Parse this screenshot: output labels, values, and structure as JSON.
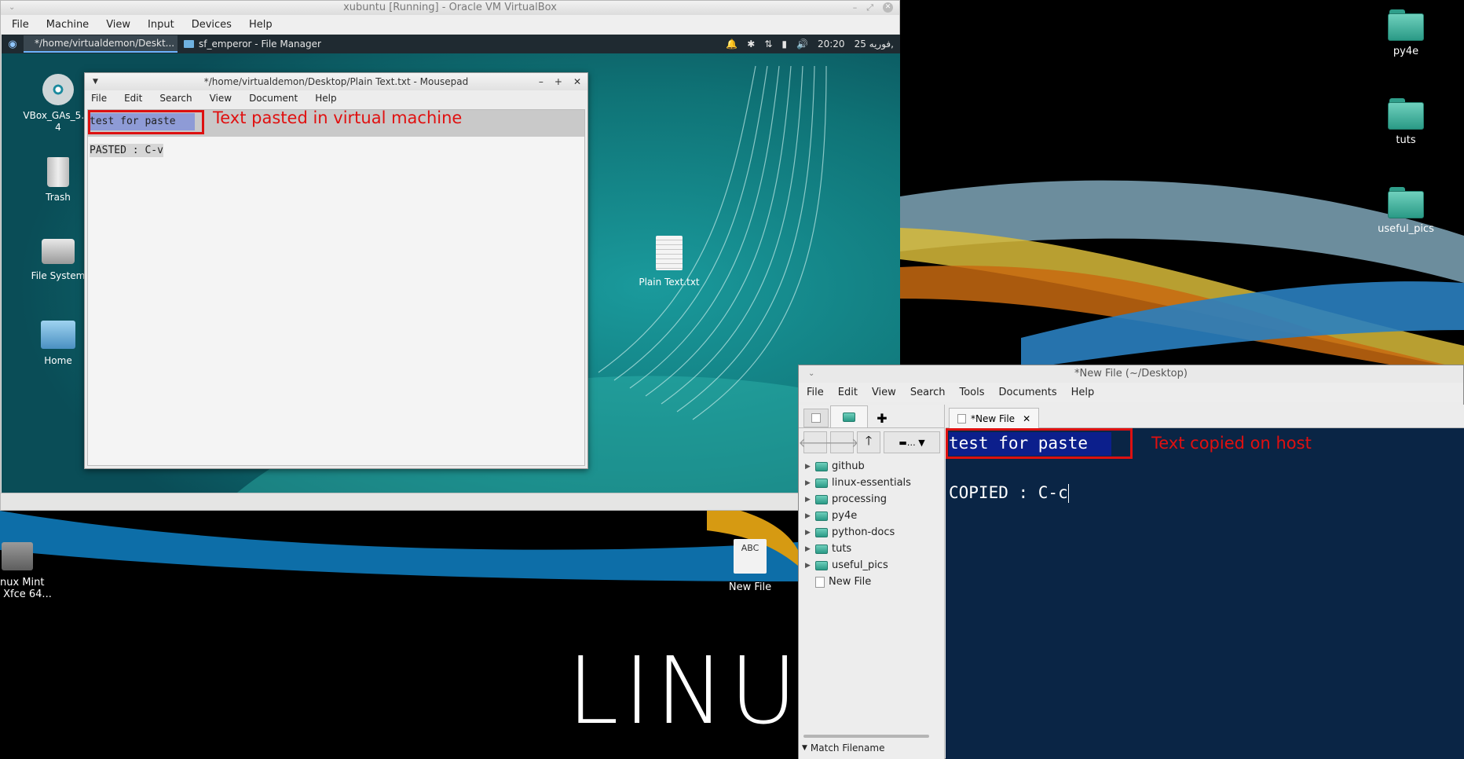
{
  "vbox": {
    "title": "xubuntu [Running] - Oracle VM VirtualBox",
    "menu": [
      "File",
      "Machine",
      "View",
      "Input",
      "Devices",
      "Help"
    ]
  },
  "guest_panel": {
    "tasks": [
      "*/home/virtualdemon/Deskt...",
      "sf_emperor - File Manager"
    ],
    "clock": "20:20",
    "date": "25 فوریه,"
  },
  "guest_desktop": {
    "icons": [
      "VBox_GAs_5.2.\n4",
      "Trash",
      "File System",
      "Home",
      "Plain Text.txt"
    ]
  },
  "mousepad": {
    "title": "*/home/virtualdemon/Desktop/Plain Text.txt - Mousepad",
    "menu": [
      "File",
      "Edit",
      "Search",
      "View",
      "Document",
      "Help"
    ],
    "line1": "test for paste",
    "line2": "PASTED : C-v",
    "annotation": "Text pasted in virtual machine"
  },
  "host_desktop": {
    "icons": [
      "py4e",
      "tuts",
      "useful_pics"
    ],
    "bottom_icons": [
      "nux Mint\n Xfce 64...",
      "New File"
    ],
    "new_file_badge": "ABC",
    "logo": "LINUX"
  },
  "gedit": {
    "title": "*New File (~/Desktop)",
    "menu": [
      "File",
      "Edit",
      "View",
      "Search",
      "Tools",
      "Documents",
      "Help"
    ],
    "tab_label": "*New File",
    "tree": [
      "github",
      "linux-essentials",
      "processing",
      "py4e",
      "python-docs",
      "tuts",
      "useful_pics",
      "New File"
    ],
    "match_filename": "Match Filename",
    "line1": "test for paste",
    "line2": "COPIED : C-c",
    "annotation": "Text copied on host"
  },
  "colors": {
    "vm_selection": "#8e9bd6",
    "gedit_bg": "#0a2545",
    "annotation": "#e01010"
  }
}
